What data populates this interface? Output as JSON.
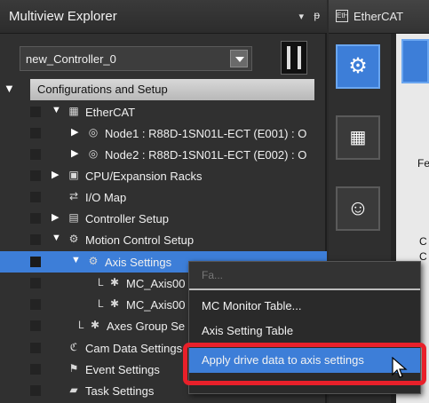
{
  "explorer": {
    "title": "Multiview Explorer",
    "pin_glyph": "▾ ᵖ",
    "controller_select": "new_Controller_0",
    "config_header": "Configurations and Setup",
    "tree": [
      {
        "label": "EtherCAT",
        "icon": "ethercat-icon",
        "icon_glyph": "▦"
      },
      {
        "label": "Node1 : R88D-1SN01L-ECT (E001) : O",
        "icon": "node-icon",
        "icon_glyph": "◎"
      },
      {
        "label": "Node2 : R88D-1SN01L-ECT (E002) : O",
        "icon": "node-icon",
        "icon_glyph": "◎"
      },
      {
        "label": "CPU/Expansion Racks",
        "icon": "rack-icon",
        "icon_glyph": "▣"
      },
      {
        "label": "I/O Map",
        "icon": "io-map-icon",
        "icon_glyph": "⇄"
      },
      {
        "label": "Controller Setup",
        "icon": "controller-setup-icon",
        "icon_glyph": "▤"
      },
      {
        "label": "Motion Control Setup",
        "icon": "motion-control-icon",
        "icon_glyph": "⚙"
      },
      {
        "label": "Axis Settings",
        "icon": "axis-settings-icon",
        "icon_glyph": "⚙"
      },
      {
        "label": "MC_Axis00",
        "icon": "axis-icon",
        "icon_glyph": "✱"
      },
      {
        "label": "MC_Axis00",
        "icon": "axis-icon",
        "icon_glyph": "✱"
      },
      {
        "label": "Axes Group Se",
        "icon": "axes-group-icon",
        "icon_glyph": "✱"
      },
      {
        "label": "Cam Data Settings",
        "icon": "cam-icon",
        "icon_glyph": "ℭ"
      },
      {
        "label": "Event Settings",
        "icon": "event-icon",
        "icon_glyph": "⚑"
      },
      {
        "label": "Task Settings",
        "icon": "task-icon",
        "icon_glyph": "▰"
      }
    ]
  },
  "editor": {
    "tab_label": "EtherCAT",
    "tab_icon_glyph": "EtH",
    "fe_text": "Fe",
    "c_text_1": "C",
    "c_text_2": "C"
  },
  "context_menu": {
    "header": "Fa...",
    "items": [
      "MC Monitor Table...",
      "Axis Setting Table",
      "Apply drive data to axis settings"
    ],
    "highlighted_index": 2
  },
  "colors": {
    "selection": "#3d7ed8",
    "highlight_outline": "#e8202a",
    "panel_bg": "#303030"
  }
}
